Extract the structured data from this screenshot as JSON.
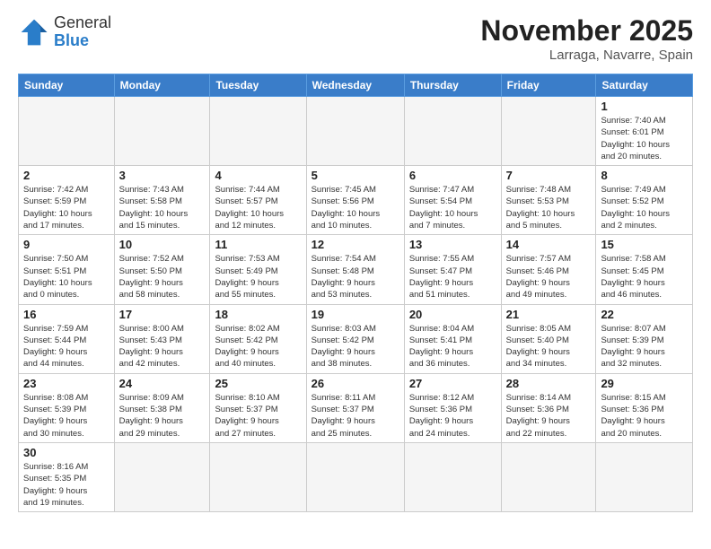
{
  "header": {
    "logo_line1": "General",
    "logo_line2": "Blue",
    "month": "November 2025",
    "location": "Larraga, Navarre, Spain"
  },
  "weekdays": [
    "Sunday",
    "Monday",
    "Tuesday",
    "Wednesday",
    "Thursday",
    "Friday",
    "Saturday"
  ],
  "weeks": [
    [
      {
        "day": "",
        "info": ""
      },
      {
        "day": "",
        "info": ""
      },
      {
        "day": "",
        "info": ""
      },
      {
        "day": "",
        "info": ""
      },
      {
        "day": "",
        "info": ""
      },
      {
        "day": "",
        "info": ""
      },
      {
        "day": "1",
        "info": "Sunrise: 7:40 AM\nSunset: 6:01 PM\nDaylight: 10 hours\nand 20 minutes."
      }
    ],
    [
      {
        "day": "2",
        "info": "Sunrise: 7:42 AM\nSunset: 5:59 PM\nDaylight: 10 hours\nand 17 minutes."
      },
      {
        "day": "3",
        "info": "Sunrise: 7:43 AM\nSunset: 5:58 PM\nDaylight: 10 hours\nand 15 minutes."
      },
      {
        "day": "4",
        "info": "Sunrise: 7:44 AM\nSunset: 5:57 PM\nDaylight: 10 hours\nand 12 minutes."
      },
      {
        "day": "5",
        "info": "Sunrise: 7:45 AM\nSunset: 5:56 PM\nDaylight: 10 hours\nand 10 minutes."
      },
      {
        "day": "6",
        "info": "Sunrise: 7:47 AM\nSunset: 5:54 PM\nDaylight: 10 hours\nand 7 minutes."
      },
      {
        "day": "7",
        "info": "Sunrise: 7:48 AM\nSunset: 5:53 PM\nDaylight: 10 hours\nand 5 minutes."
      },
      {
        "day": "8",
        "info": "Sunrise: 7:49 AM\nSunset: 5:52 PM\nDaylight: 10 hours\nand 2 minutes."
      }
    ],
    [
      {
        "day": "9",
        "info": "Sunrise: 7:50 AM\nSunset: 5:51 PM\nDaylight: 10 hours\nand 0 minutes."
      },
      {
        "day": "10",
        "info": "Sunrise: 7:52 AM\nSunset: 5:50 PM\nDaylight: 9 hours\nand 58 minutes."
      },
      {
        "day": "11",
        "info": "Sunrise: 7:53 AM\nSunset: 5:49 PM\nDaylight: 9 hours\nand 55 minutes."
      },
      {
        "day": "12",
        "info": "Sunrise: 7:54 AM\nSunset: 5:48 PM\nDaylight: 9 hours\nand 53 minutes."
      },
      {
        "day": "13",
        "info": "Sunrise: 7:55 AM\nSunset: 5:47 PM\nDaylight: 9 hours\nand 51 minutes."
      },
      {
        "day": "14",
        "info": "Sunrise: 7:57 AM\nSunset: 5:46 PM\nDaylight: 9 hours\nand 49 minutes."
      },
      {
        "day": "15",
        "info": "Sunrise: 7:58 AM\nSunset: 5:45 PM\nDaylight: 9 hours\nand 46 minutes."
      }
    ],
    [
      {
        "day": "16",
        "info": "Sunrise: 7:59 AM\nSunset: 5:44 PM\nDaylight: 9 hours\nand 44 minutes."
      },
      {
        "day": "17",
        "info": "Sunrise: 8:00 AM\nSunset: 5:43 PM\nDaylight: 9 hours\nand 42 minutes."
      },
      {
        "day": "18",
        "info": "Sunrise: 8:02 AM\nSunset: 5:42 PM\nDaylight: 9 hours\nand 40 minutes."
      },
      {
        "day": "19",
        "info": "Sunrise: 8:03 AM\nSunset: 5:42 PM\nDaylight: 9 hours\nand 38 minutes."
      },
      {
        "day": "20",
        "info": "Sunrise: 8:04 AM\nSunset: 5:41 PM\nDaylight: 9 hours\nand 36 minutes."
      },
      {
        "day": "21",
        "info": "Sunrise: 8:05 AM\nSunset: 5:40 PM\nDaylight: 9 hours\nand 34 minutes."
      },
      {
        "day": "22",
        "info": "Sunrise: 8:07 AM\nSunset: 5:39 PM\nDaylight: 9 hours\nand 32 minutes."
      }
    ],
    [
      {
        "day": "23",
        "info": "Sunrise: 8:08 AM\nSunset: 5:39 PM\nDaylight: 9 hours\nand 30 minutes."
      },
      {
        "day": "24",
        "info": "Sunrise: 8:09 AM\nSunset: 5:38 PM\nDaylight: 9 hours\nand 29 minutes."
      },
      {
        "day": "25",
        "info": "Sunrise: 8:10 AM\nSunset: 5:37 PM\nDaylight: 9 hours\nand 27 minutes."
      },
      {
        "day": "26",
        "info": "Sunrise: 8:11 AM\nSunset: 5:37 PM\nDaylight: 9 hours\nand 25 minutes."
      },
      {
        "day": "27",
        "info": "Sunrise: 8:12 AM\nSunset: 5:36 PM\nDaylight: 9 hours\nand 24 minutes."
      },
      {
        "day": "28",
        "info": "Sunrise: 8:14 AM\nSunset: 5:36 PM\nDaylight: 9 hours\nand 22 minutes."
      },
      {
        "day": "29",
        "info": "Sunrise: 8:15 AM\nSunset: 5:36 PM\nDaylight: 9 hours\nand 20 minutes."
      }
    ],
    [
      {
        "day": "30",
        "info": "Sunrise: 8:16 AM\nSunset: 5:35 PM\nDaylight: 9 hours\nand 19 minutes."
      },
      {
        "day": "",
        "info": ""
      },
      {
        "day": "",
        "info": ""
      },
      {
        "day": "",
        "info": ""
      },
      {
        "day": "",
        "info": ""
      },
      {
        "day": "",
        "info": ""
      },
      {
        "day": "",
        "info": ""
      }
    ]
  ]
}
